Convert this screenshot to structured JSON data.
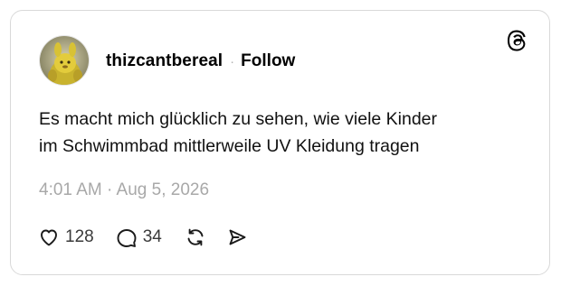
{
  "post": {
    "username": "thizcantbereal",
    "separator": "·",
    "follow_label": "Follow",
    "text": "Es macht mich glücklich zu sehen, wie viele Kinder\nim Schwimmbad mittlerweile UV Kleidung tragen",
    "timestamp": "4:01 AM · Aug 5, 2026",
    "likes": "128",
    "replies": "34"
  },
  "icons": {
    "brand": "threads-logo-icon",
    "like": "heart-icon",
    "reply": "speech-bubble-icon",
    "repost": "repost-icon",
    "share": "send-icon"
  },
  "colors": {
    "text": "#000000",
    "muted": "#a8a8a8",
    "border": "#d9d9d9"
  }
}
